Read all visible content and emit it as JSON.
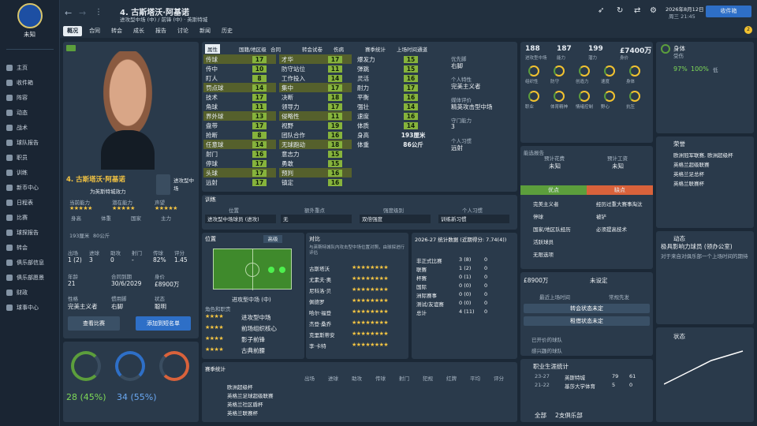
{
  "sidebar": {
    "club": "未知",
    "items": [
      "主页",
      "收件箱",
      "阵容",
      "动态",
      "战术",
      "球队报告",
      "职员",
      "训练",
      "新币中心",
      "日程表",
      "比赛",
      "球探报告",
      "转会",
      "俱乐部信息",
      "俱乐部愿景",
      "财政",
      "球事中心"
    ]
  },
  "header": {
    "title": "4. 古斯塔沃·阿基诺",
    "subtitle": "进攻型中场 (中) / 前锋 (中) · 英斯特城",
    "date": "2026年8月12日",
    "weekday": "周三 21:45",
    "continue": "收件箱"
  },
  "tabs": [
    "概况",
    "合同",
    "转会",
    "成长",
    "报告",
    "讨论",
    "新闻",
    "历史"
  ],
  "profile": {
    "name": "4. 古斯塔沃·阿基诺",
    "role_line1": "进攻型中",
    "role_line2": "场",
    "club": "为英斯特城效力",
    "headers": [
      "当前能力",
      "潜在能力",
      "声望"
    ],
    "stats": [
      {
        "l": "出场",
        "v": "1 (2)"
      },
      {
        "l": "进球",
        "v": "3"
      },
      {
        "l": "助攻",
        "v": "0"
      },
      {
        "l": "射门",
        "v": "-"
      },
      {
        "l": "传球",
        "v": "82%"
      },
      {
        "l": "评分",
        "v": "1.45"
      }
    ],
    "info": [
      {
        "l": "年龄",
        "v": "21"
      },
      {
        "l": "合同到期",
        "v": "30/6/2029"
      },
      {
        "l": "身价",
        "v": "£8900万"
      }
    ],
    "personality": [
      {
        "l": "性格",
        "v": "完美主义者"
      },
      {
        "l": "惯用脚",
        "v": "右脚"
      },
      {
        "l": "状态",
        "v": "聪明"
      }
    ],
    "tags": [
      "身高",
      "体重",
      "国家",
      "主力"
    ],
    "tagvals": [
      "193厘米",
      "80公斤"
    ],
    "buttons": [
      "查看比赛",
      "添加到短名单"
    ]
  },
  "attributes": {
    "tabs": [
      "属性",
      "国籍/地区级",
      "合同",
      "转会试卷",
      "伤病",
      "赛季统计",
      "上场时间通道"
    ],
    "col1": [
      {
        "n": "传球",
        "v": "17"
      },
      {
        "n": "传中",
        "v": "10"
      },
      {
        "n": "盯人",
        "v": "8"
      },
      {
        "n": "罚点球",
        "v": "14"
      },
      {
        "n": "技术",
        "v": "17"
      },
      {
        "n": "角球",
        "v": "11"
      },
      {
        "n": "界外球",
        "v": "13"
      },
      {
        "n": "盘带",
        "v": "17"
      },
      {
        "n": "抢断",
        "v": "8"
      },
      {
        "n": "任意球",
        "v": "14"
      },
      {
        "n": "射门",
        "v": "16"
      },
      {
        "n": "停球",
        "v": "17"
      },
      {
        "n": "头球",
        "v": "17"
      },
      {
        "n": "远射",
        "v": "17"
      }
    ],
    "col2": [
      {
        "n": "才华",
        "v": "17"
      },
      {
        "n": "防守站位",
        "v": "11"
      },
      {
        "n": "工作投入",
        "v": "14"
      },
      {
        "n": "集中",
        "v": "17"
      },
      {
        "n": "决断",
        "v": "18"
      },
      {
        "n": "领导力",
        "v": "17"
      },
      {
        "n": "侵略性",
        "v": "11"
      },
      {
        "n": "视野",
        "v": "19"
      },
      {
        "n": "团队合作",
        "v": "16"
      },
      {
        "n": "无球跑动",
        "v": "18"
      },
      {
        "n": "意志力",
        "v": "15"
      },
      {
        "n": "勇敢",
        "v": "15"
      },
      {
        "n": "预判",
        "v": "16"
      },
      {
        "n": "镇定",
        "v": "16"
      }
    ],
    "col3": [
      {
        "n": "爆发力",
        "v": "15"
      },
      {
        "n": "弹跳",
        "v": "15"
      },
      {
        "n": "灵活",
        "v": "16"
      },
      {
        "n": "耐力",
        "v": "17"
      },
      {
        "n": "平衡",
        "v": "16"
      },
      {
        "n": "强壮",
        "v": "14"
      },
      {
        "n": "速度",
        "v": "16"
      },
      {
        "n": "体质",
        "v": "14"
      },
      {
        "n": "身高",
        "v": "193厘米"
      },
      {
        "n": "体重",
        "v": "86公斤"
      }
    ],
    "extra": [
      {
        "l": "优先脚",
        "v": "右脚"
      },
      {
        "l": "个人特性",
        "v": "完美主义者"
      },
      {
        "l": "媒体评价",
        "v": "精英攻击型中场"
      },
      {
        "l": "守门能力",
        "v": "3"
      },
      {
        "l": "个人习惯",
        "v": "远射"
      }
    ]
  },
  "training": {
    "title": "训练",
    "cols": [
      "位置",
      "额外重点",
      "强度级别",
      "个人习惯"
    ],
    "vals": [
      "进攻型中场球员 (进攻)",
      "无",
      "双倍强度",
      "训练新习惯"
    ]
  },
  "position": {
    "title": "位置",
    "mode": "高级",
    "role": "进攻型中场 (中)",
    "roles_title": "角色和职责",
    "roles": [
      "进攻型中场",
      "前场组织核心",
      "影子前锋",
      "古典前腰"
    ]
  },
  "compare": {
    "title": "对比",
    "desc": "与英斯特城队内攻击型中场位置对照，由球探进行评估",
    "players": [
      "古斯塔沃",
      "尤素夫·奥",
      "尼科洛·贝",
      "佩德罗",
      "哈尔·福登",
      "杰登·桑乔",
      "克里斯蒂安",
      "李·卡特"
    ]
  },
  "season": {
    "title": "2026-27 统计数据 (近期得分: 7.74(4))",
    "rows": [
      {
        "l": "非正式比赛",
        "a": "3 (8)",
        "b": "0"
      },
      {
        "l": "联赛",
        "a": "1 (2)",
        "b": "0"
      },
      {
        "l": "杯赛",
        "a": "0 (1)",
        "b": "0"
      },
      {
        "l": "国际",
        "a": "0 (0)",
        "b": "0"
      },
      {
        "l": "洲际赛事",
        "a": "0 (0)",
        "b": "0"
      },
      {
        "l": "测试/友谊赛",
        "a": "0 (0)",
        "b": "0"
      },
      {
        "l": "总计",
        "a": "4 (11)",
        "b": "0"
      }
    ]
  },
  "summary": {
    "nums": [
      {
        "v": "188",
        "l": "进攻型中场"
      },
      {
        "v": "187",
        "l": "能力"
      },
      {
        "v": "199",
        "l": "潜力"
      },
      {
        "v": "£7400万",
        "l": "身价"
      }
    ],
    "icons": [
      "组织性",
      "防守",
      "创造力",
      "速度",
      "身体"
    ],
    "icons2": [
      "职业",
      "体育精神",
      "情绪控制",
      "野心",
      "抗压"
    ]
  },
  "scout": {
    "title": "能选报告",
    "cols": [
      "预计花费",
      "预计工资"
    ],
    "vals": [
      "未知",
      "未知"
    ],
    "sub": [
      "转会花费",
      "周薪"
    ],
    "pros_title": "优点",
    "cons_title": "缺点",
    "pros": [
      "完美主义者",
      "停球",
      "国家/地区队经历",
      "活跃球员",
      "无限选项"
    ],
    "cons": [
      "经历过重大赛事淘汰",
      "被铲",
      "必须提高技术"
    ]
  },
  "value": {
    "v": "£8900万",
    "v2": "未设定",
    "l1": "最近上场时间",
    "l2": "常规先发",
    "btn1": "转会状态未定",
    "btn2": "租借状态未定",
    "list": [
      "已开价的球队",
      "感兴趣的球队"
    ]
  },
  "career": {
    "title": "职业生涯统计",
    "rows": [
      {
        "y": "23-27",
        "c": "英斯特城",
        "a": "79",
        "b": "61"
      },
      {
        "y": "21-22",
        "c": "基莎大学体育",
        "a": "5",
        "b": "0"
      }
    ],
    "total_l": "全部",
    "total_v": "2支俱乐部"
  },
  "right": {
    "fitness": "身体",
    "fit_v": "受伤",
    "morale": "97%",
    "morale2": "100%",
    "low": "低",
    "honors_title": "荣誉",
    "honors": [
      "欧洲冠军联赛, 欧洲超级杯",
      "英格兰超级联赛",
      "英格兰足总杯",
      "英格兰联赛杯"
    ],
    "news_title": "动态",
    "news": "极具影响力球员 (领办公室)",
    "news_sub": "对于来自对俱乐部一个上场时间的期待",
    "form": "状态"
  },
  "competitions": {
    "title": "赛季统计",
    "rows": [
      "欧洲超级杯",
      "英格兰足球超级联赛",
      "英格兰社区盾杯",
      "英格兰联赛杯"
    ],
    "cols": [
      "出场",
      "进球",
      "助攻",
      "传球",
      "射门",
      "犯规",
      "红牌",
      "平均",
      "评分"
    ]
  },
  "colors": {
    "accent": "#86b33c",
    "star": "#f5c542",
    "pro": "#5c9e3c",
    "con": "#d9623b"
  }
}
